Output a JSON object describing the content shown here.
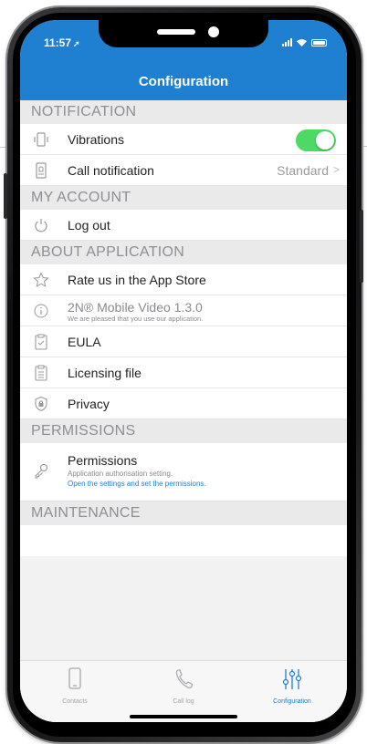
{
  "status_bar": {
    "time": "11:57",
    "location_arrow": "➚"
  },
  "nav": {
    "title": "Configuration"
  },
  "sections": {
    "notification": "NOTIFICATION",
    "my_account": "MY ACCOUNT",
    "about_application": "ABOUT APPLICATION",
    "permissions": "PERMISSIONS",
    "maintenance": "MAINTENANCE"
  },
  "rows": {
    "vibrations": {
      "label": "Vibrations",
      "toggle_on": true
    },
    "call_notification": {
      "label": "Call notification",
      "value": "Standard",
      "chevron": ">"
    },
    "log_out": {
      "label": "Log out"
    },
    "rate_us": {
      "label": "Rate us in the App Store"
    },
    "app_version": {
      "label": "2N® Mobile Video 1.3.0",
      "sub": "We are pleased that you use our application."
    },
    "eula": {
      "label": "EULA"
    },
    "licensing_file": {
      "label": "Licensing file"
    },
    "privacy": {
      "label": "Privacy"
    },
    "permissions": {
      "label": "Permissions",
      "sub": "Application authorisation setting.",
      "link": "Open the settings and set the permissions."
    }
  },
  "tabs": [
    {
      "label": "Contacts",
      "icon": "phone-device-icon",
      "active": false
    },
    {
      "label": "Call log",
      "icon": "handset-icon",
      "active": false
    },
    {
      "label": "Configuration",
      "icon": "sliders-icon",
      "active": true
    }
  ],
  "colors": {
    "accent": "#1f7fd0",
    "toggle_on": "#4cd964",
    "section_bg": "#eaeaeb",
    "section_text": "#8f8f93"
  }
}
